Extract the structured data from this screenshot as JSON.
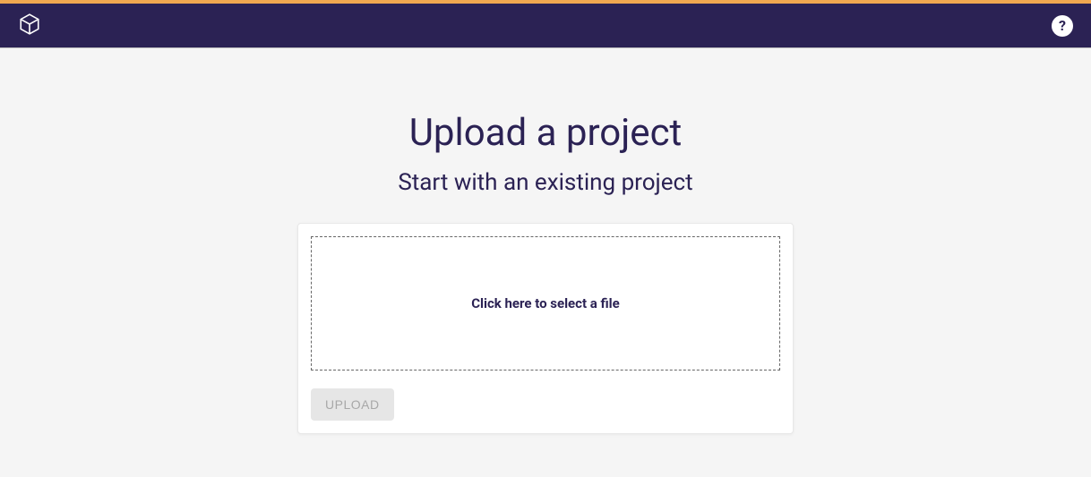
{
  "colors": {
    "accent": "#f0a850",
    "primary": "#2b2254",
    "background": "#f5f5f5"
  },
  "header": {
    "logo_icon": "cube-icon",
    "help_icon": "help-icon",
    "help_symbol": "?"
  },
  "main": {
    "title": "Upload a project",
    "subtitle": "Start with an existing project",
    "dropzone_text": "Click here to select a file",
    "upload_button_label": "UPLOAD",
    "upload_button_enabled": false
  }
}
